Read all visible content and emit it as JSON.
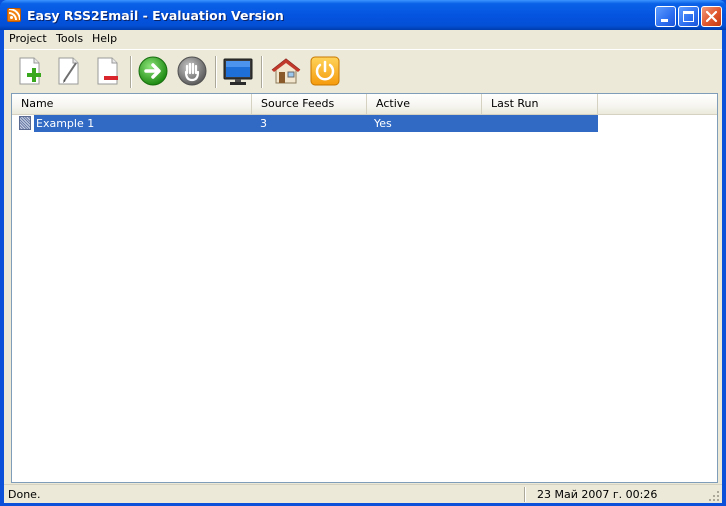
{
  "window": {
    "title": "Easy RSS2Email - Evaluation Version",
    "icon": "rss-icon"
  },
  "menu": {
    "items": [
      "Project",
      "Tools",
      "Help"
    ]
  },
  "toolbar": {
    "buttons": [
      {
        "icon": "add-project-icon"
      },
      {
        "icon": "edit-project-icon"
      },
      {
        "icon": "delete-project-icon"
      },
      {
        "icon": "run-icon"
      },
      {
        "icon": "stop-icon"
      },
      {
        "icon": "monitor-icon"
      },
      {
        "icon": "home-icon"
      },
      {
        "icon": "power-icon"
      }
    ]
  },
  "list": {
    "columns": [
      "Name",
      "Source Feeds",
      "Active",
      "Last Run"
    ],
    "rows": [
      {
        "name": "Example 1",
        "source_feeds": "3",
        "active": "Yes",
        "last_run": ""
      }
    ]
  },
  "status": {
    "left": "Done.",
    "right": "23 Май 2007 г. 00:26"
  },
  "colors": {
    "titlebar": "#0554e0",
    "selection": "#316ac5",
    "face": "#ece9d8"
  }
}
